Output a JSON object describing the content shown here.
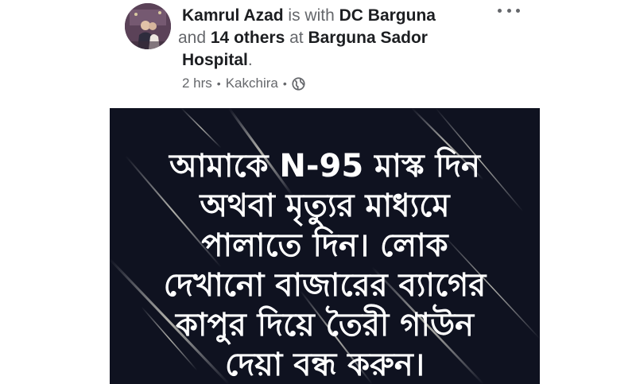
{
  "post": {
    "author": "Kamrul Azad",
    "with_text": " is with ",
    "tagged_primary": "DC Barguna",
    "and_text": " and ",
    "others": "14 others",
    "at_text": " at ",
    "location": "Barguna Sador Hospital",
    "period": ".",
    "time": "2 hrs",
    "sep1": "•",
    "place": "Kakchira",
    "sep2": "•",
    "privacy_icon": "globe-icon",
    "more_icon": "more-options-icon"
  },
  "image": {
    "lines": [
      "আমাকে N-95 মাস্ক দিন",
      "অথবা মৃত্যুর মাধ্যমে",
      "পালাতে দিন। লোক",
      "দেখানো বাজারের ব্যাগের",
      "কাপুর দিয়ে তৈরী  গাউন",
      "দেয়া বন্ধ করুন।"
    ]
  },
  "colors": {
    "image_background": "#0f1220",
    "secondary_text": "#65676b",
    "primary_text": "#1c1e21"
  }
}
